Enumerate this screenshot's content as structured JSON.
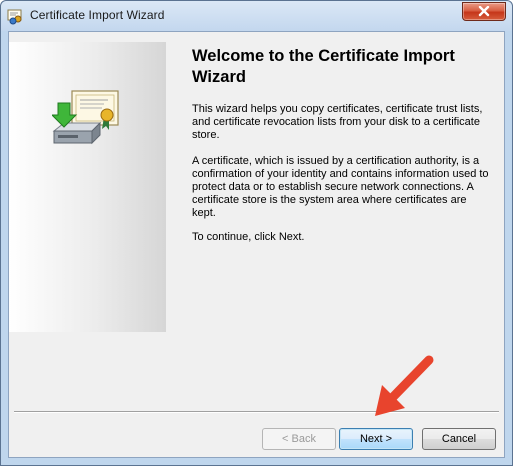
{
  "window": {
    "title": "Certificate Import Wizard",
    "close_icon": "close-icon"
  },
  "main": {
    "heading": "Welcome to the Certificate Import Wizard",
    "paragraphs": [
      "This wizard helps you copy certificates, certificate trust lists, and certificate revocation lists from your disk to a certificate store.",
      "A certificate, which is issued by a certification authority, is a confirmation of your identity and contains information used to protect data or to establish secure network connections. A certificate store is the system area where certificates are kept.",
      "To continue, click Next."
    ]
  },
  "buttons": {
    "back_label": "< Back",
    "next_label": "Next >",
    "cancel_label": "Cancel"
  },
  "colors": {
    "annotation_arrow": "#e8442d",
    "next_button_border": "#3c7fb1"
  },
  "icons": {
    "app": "certificate-icon",
    "wizard_graphic": "certificate-import-icon",
    "annotation": "red-arrow-icon"
  }
}
